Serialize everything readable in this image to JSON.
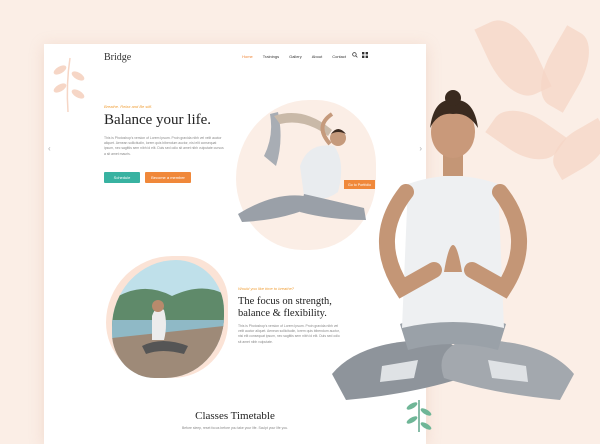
{
  "brand": {
    "logo": "Bridge"
  },
  "nav": {
    "items": [
      "Home",
      "Trainings",
      "Gallery",
      "About",
      "Contact"
    ],
    "search_icon": "search-icon",
    "grid_icon": "grid-icon"
  },
  "hero": {
    "eyebrow": "Breathe. Relax and Be still.",
    "title": "Balance your life.",
    "text": "This is Photoshop's version of Lorem Ipsum. Proin gravida nibh vel velit auctor aliquet. Aenean sollicitudin, lorem quis bibendum auctor, nisi elit consequat ipsum, nec sagittis sem nibh id elit. Duis sed odio sit amet nibh vulputate cursus a sit amet mauris.",
    "primary_button": "Schedule",
    "secondary_button": "Become a member",
    "tag_button": "Go to Portfolio",
    "prev_arrow": "‹",
    "next_arrow": "›"
  },
  "focus": {
    "eyebrow": "Would you like time to breathe?",
    "title": "The focus on strength, balance & flexibility.",
    "text": "This is Photoshop's version of Lorem Ipsum. Proin gravida nibh vel velit auctor aliquet. Aenean sollicitudin, lorem quis bibendum auctor, nisi elit consequat ipsum, nec sagittis sem nibh id elit. Duis sed odio sit amet nibh vulputate."
  },
  "timetable": {
    "title": "Classes Timetable",
    "text": "Before sleep, reset focus before you take your life. Sculpt your life you."
  },
  "colors": {
    "accent": "#f0883a",
    "teal": "#38b2a1",
    "background": "#fbeee6"
  }
}
